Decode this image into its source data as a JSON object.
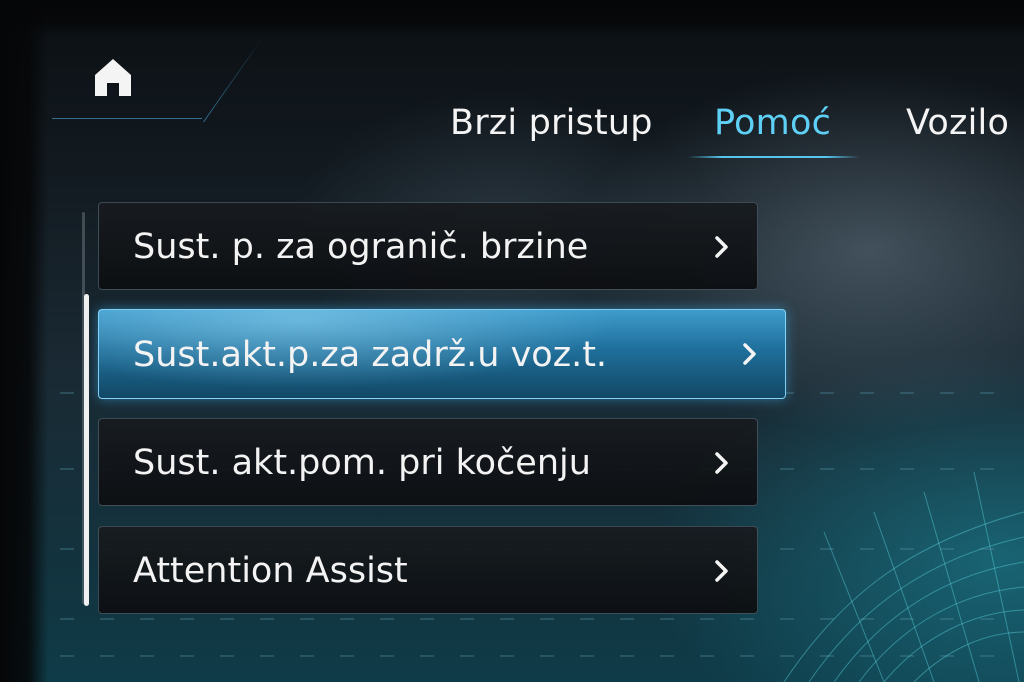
{
  "header": {
    "home_icon": "home-icon",
    "tabs": [
      {
        "label": "Brzi pristup",
        "active": false
      },
      {
        "label": "Pomoć",
        "active": true
      },
      {
        "label": "Vozilo",
        "active": false
      }
    ]
  },
  "menu": {
    "items": [
      {
        "label": "Sust. p. za ogranič. brzine",
        "icon": "chevron-right-icon",
        "selected": false
      },
      {
        "label": "Sust.akt.p.za zadrž.u voz.t.",
        "icon": "chevron-right-icon",
        "selected": true
      },
      {
        "label": "Sust. akt.pom. pri kočenju",
        "icon": "chevron-right-icon",
        "selected": false
      },
      {
        "label": "Attention Assist",
        "icon": "chevron-right-icon",
        "selected": false
      }
    ]
  },
  "colors": {
    "accent": "#5fd0f5",
    "selected_item": "#2a86b6",
    "text": "#f3f3f3"
  }
}
